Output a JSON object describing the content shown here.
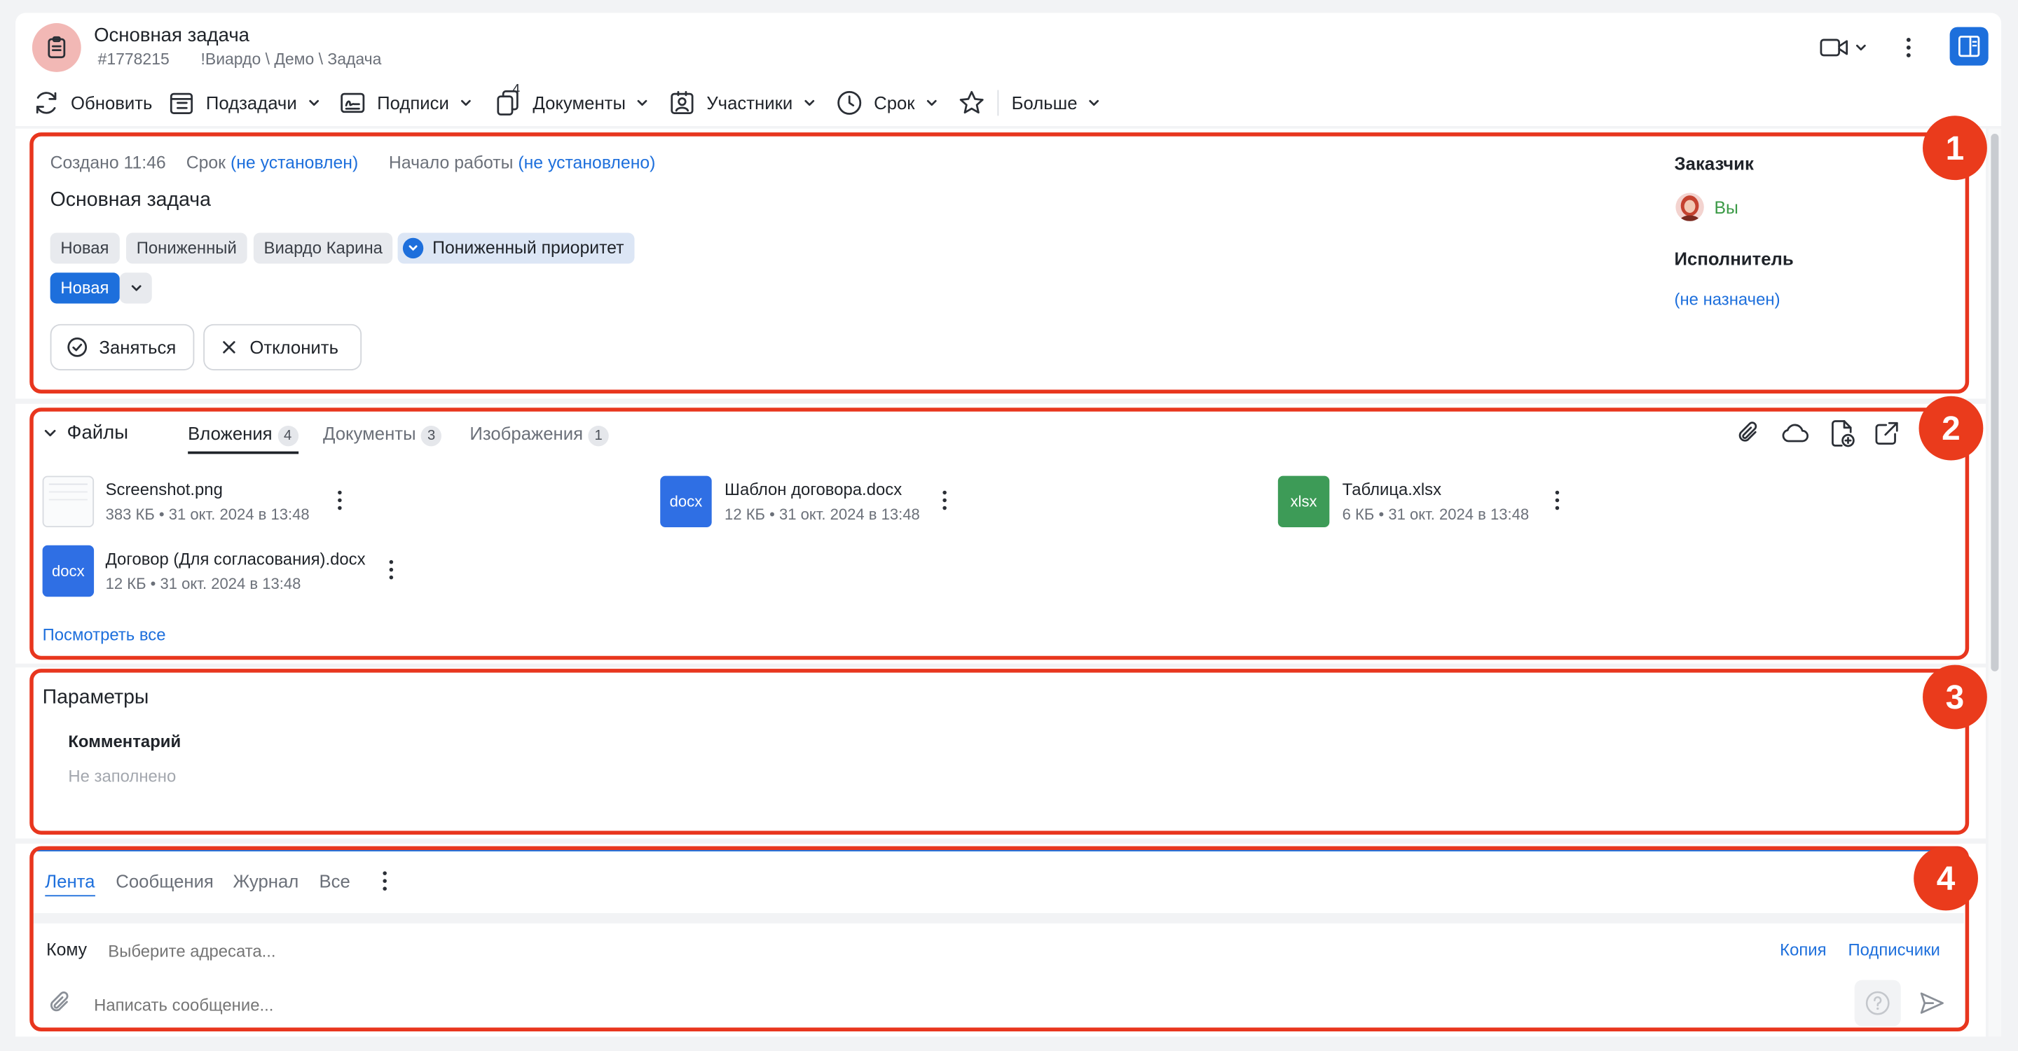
{
  "header": {
    "title": "Основная задача",
    "task_id": "#1778215",
    "path": "!Виардо \\ Демо \\ Задача"
  },
  "toolbar": {
    "refresh": "Обновить",
    "subtasks": "Подзадачи",
    "signatures": "Подписи",
    "documents": "Документы",
    "documents_count": "4",
    "participants": "Участники",
    "deadline": "Срок",
    "more": "Больше"
  },
  "info": {
    "created_label": "Создано 11:46",
    "deadline_label": "Срок",
    "deadline_value": "(не установлен)",
    "start_label": "Начало работы",
    "start_value": "(не установлено)",
    "task_title": "Основная задача",
    "tags": [
      "Новая",
      "Пониженный",
      "Виардо Карина"
    ],
    "priority_tag": "Пониженный приоритет",
    "status": "Новая",
    "take_button": "Заняться",
    "reject_button": "Отклонить",
    "customer_label": "Заказчик",
    "customer_value": "Вы",
    "executor_label": "Исполнитель",
    "executor_value": "(не назначен)"
  },
  "files": {
    "section_title": "Файлы",
    "tabs": [
      {
        "label": "Вложения",
        "count": "4"
      },
      {
        "label": "Документы",
        "count": "3"
      },
      {
        "label": "Изображения",
        "count": "1"
      }
    ],
    "items": [
      {
        "name": "Screenshot.png",
        "meta": "383 КБ • 31 окт. 2024 в 13:48",
        "type": "png"
      },
      {
        "name": "Шаблон договора.docx",
        "meta": "12 КБ • 31 окт. 2024 в 13:48",
        "type": "docx"
      },
      {
        "name": "Таблица.xlsx",
        "meta": "6 КБ • 31 окт. 2024 в 13:48",
        "type": "xlsx"
      },
      {
        "name": "Договор (Для согласования).docx",
        "meta": "12 КБ • 31 окт. 2024 в 13:48",
        "type": "docx"
      }
    ],
    "view_all": "Посмотреть все"
  },
  "params": {
    "title": "Параметры",
    "comment_label": "Комментарий",
    "comment_value": "Не заполнено"
  },
  "feed": {
    "tabs": [
      "Лента",
      "Сообщения",
      "Журнал",
      "Все"
    ],
    "to_label": "Кому",
    "to_placeholder": "Выберите адресата...",
    "copy": "Копия",
    "subscribers": "Подписчики",
    "message_placeholder": "Написать сообщение..."
  },
  "annotations": [
    "1",
    "2",
    "3",
    "4"
  ],
  "colors": {
    "accent": "#1d6fdc",
    "annotation": "#e8361e",
    "docx": "#2f6fe4",
    "xlsx": "#3d9b57",
    "customer": "#3b9a46"
  }
}
